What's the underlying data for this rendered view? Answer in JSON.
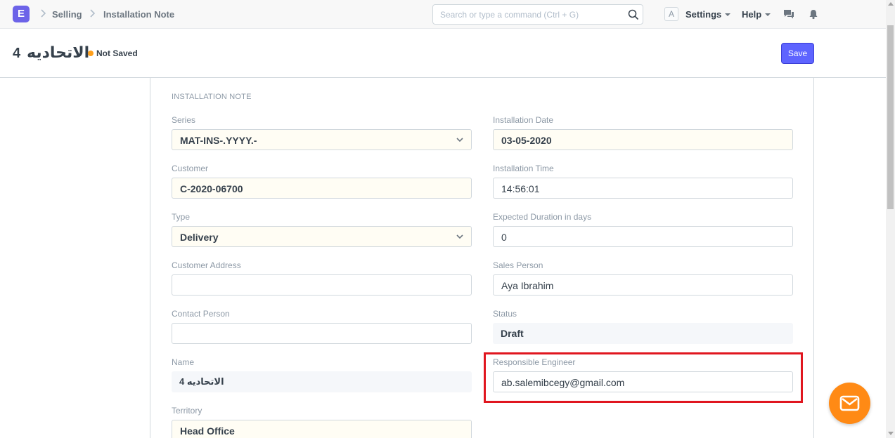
{
  "navbar": {
    "logo_letter": "E",
    "breadcrumbs": [
      "Selling",
      "Installation Note"
    ],
    "search_placeholder": "Search or type a command (Ctrl + G)",
    "avatar_letter": "A",
    "settings_label": "Settings",
    "help_label": "Help"
  },
  "page": {
    "title_arabic": "الاتحاديه",
    "title_number": "4",
    "status": "Not Saved",
    "status_color": "#ff9f1a",
    "save_label": "Save"
  },
  "form": {
    "section_title": "INSTALLATION NOTE",
    "left": {
      "series": {
        "label": "Series",
        "value": "MAT-INS-.YYYY.-"
      },
      "customer": {
        "label": "Customer",
        "value": "C-2020-06700"
      },
      "type": {
        "label": "Type",
        "value": "Delivery"
      },
      "customer_address": {
        "label": "Customer Address",
        "value": ""
      },
      "contact_person": {
        "label": "Contact Person",
        "value": ""
      },
      "name": {
        "label": "Name",
        "value": "الاتحاديه 4"
      },
      "territory": {
        "label": "Territory",
        "value": "Head Office"
      }
    },
    "right": {
      "installation_date": {
        "label": "Installation Date",
        "value": "03-05-2020"
      },
      "installation_time": {
        "label": "Installation Time",
        "value": "14:56:01"
      },
      "expected_duration": {
        "label": "Expected Duration in days",
        "value": "0"
      },
      "sales_person": {
        "label": "Sales Person",
        "value": "Aya Ibrahim"
      },
      "status": {
        "label": "Status",
        "value": "Draft"
      },
      "responsible_engineer": {
        "label": "Responsible Engineer",
        "value": "ab.salemibcegy@gmail.com"
      }
    }
  },
  "colors": {
    "primary": "#5e64ff",
    "highlight": "#e0161f",
    "fab": "#ff8a15"
  },
  "icons": [
    "app-logo-icon",
    "chevron-right-icon",
    "search-icon",
    "chat-icon",
    "bell-icon",
    "chevron-down-icon",
    "mail-icon"
  ]
}
